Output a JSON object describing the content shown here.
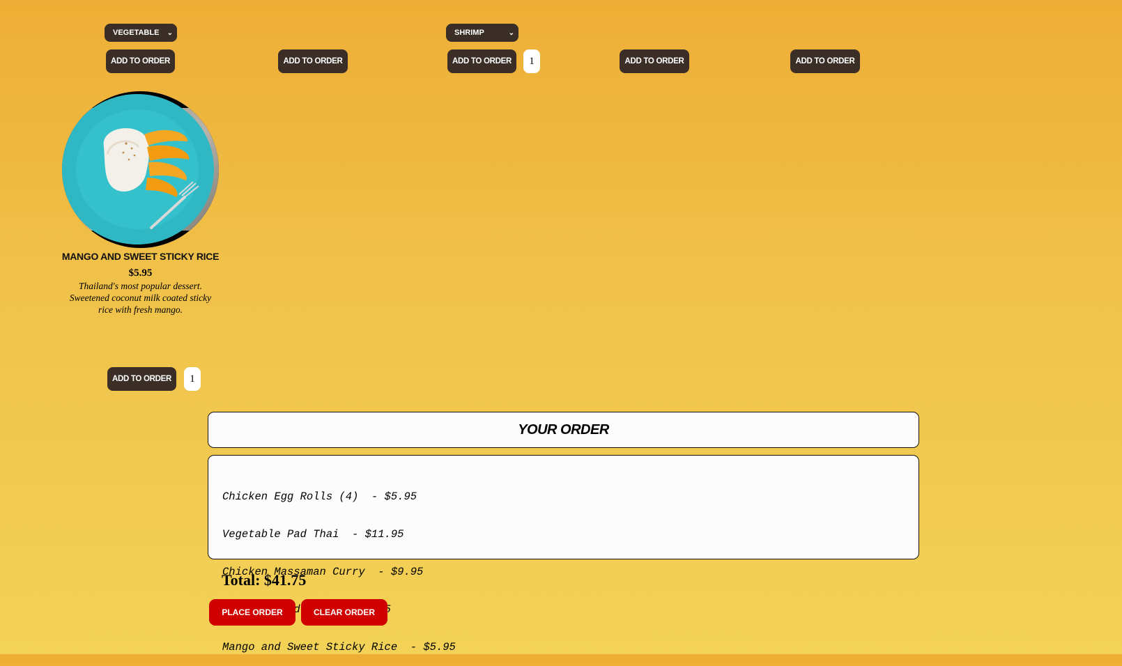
{
  "top_row": {
    "selects": [
      {
        "value": "Vegetable"
      },
      {
        "value": "Shrimp"
      }
    ],
    "add_label": "Add to Order",
    "qty_value": "1"
  },
  "dessert": {
    "name": "Mango and Sweet Sticky Rice",
    "price": "$5.95",
    "description": "Thailand's most popular dessert. Sweetened coconut milk coated sticky rice with fresh mango.",
    "add_label": "Add to Order",
    "qty_value": "1"
  },
  "order": {
    "header": "Your Order",
    "items": [
      "Chicken Egg Rolls (4)  - $5.95",
      "Vegetable Pad Thai  - $11.95",
      "Chicken Massaman Curry  - $9.95",
      "Shrimp Fried Rice  - $7.95",
      "Mango and Sweet Sticky Rice  - $5.95"
    ],
    "total": "Total: $41.75",
    "place_label": "Place Order",
    "clear_label": "Clear Order"
  },
  "colors": {
    "accent_dark": "#3a2e26",
    "accent_red": "#d00000",
    "background_top": "#eeae36",
    "background_bottom": "#f3d257"
  },
  "icons": {
    "select_chevron": "chevron-down-icon"
  }
}
